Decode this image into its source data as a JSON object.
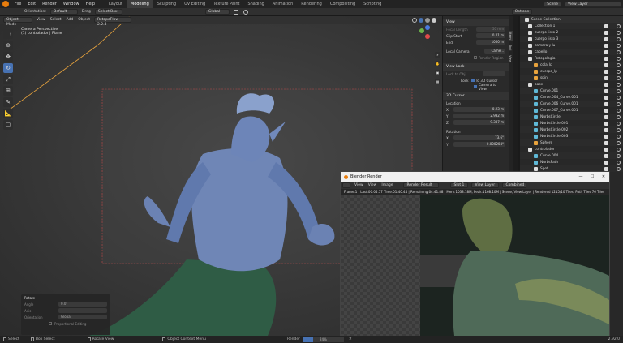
{
  "topbar": {
    "menus": [
      "File",
      "Edit",
      "Render",
      "Window",
      "Help"
    ],
    "workspaces": [
      "Layout",
      "Modeling",
      "Sculpting",
      "UV Editing",
      "Texture Paint",
      "Shading",
      "Animation",
      "Rendering",
      "Compositing",
      "Scripting"
    ],
    "active_workspace": "Modeling",
    "scene": "Scene",
    "view_layer": "View Layer"
  },
  "header": {
    "orientation_label": "Orientation:",
    "orientation_value": "Default",
    "drag_label": "Drag",
    "select_box": "Select Box",
    "transform": "Global",
    "options": "Options"
  },
  "viewport": {
    "mode": "Object Mode",
    "menus": [
      "View",
      "Select",
      "Add",
      "Object"
    ],
    "retopoflow": "RetopoFlow 2.2.4",
    "camera_line1": "Camera Perspective",
    "camera_line2": "(1) controlador | Plane"
  },
  "npanel": {
    "view_section": "View",
    "focal_length_label": "Focal Length",
    "focal_length": "50 mm",
    "clip_start_label": "Clip Start",
    "clip_start": "0.01 m",
    "end_label": "End",
    "clip_end": "1000 m",
    "local_camera_label": "Local Camera",
    "local_camera_value": "Came...",
    "render_region": "Render Region",
    "view_lock_section": "View Lock",
    "lock_to_object": "Lock to Obj...",
    "lock_label": "Lock",
    "to_3d_cursor": "To 3D Cursor",
    "camera_to_view": "Camera to View",
    "cursor_section": "3D Cursor",
    "location_label": "Location",
    "loc_x_label": "X",
    "loc_x": "0.23 m",
    "loc_y_label": "Y",
    "loc_y": "2.932 m",
    "loc_z_label": "Z",
    "loc_z": "-9.337 m",
    "rotation_label": "Rotation",
    "rot_x_label": "X",
    "rot_x": "73.6°",
    "rot_y_label": "Y",
    "rot_y": "-0.000204°",
    "tabs": [
      "Item",
      "Tool",
      "View"
    ]
  },
  "outliner": {
    "header": "Scene Collection",
    "items": [
      {
        "label": "Collection 1",
        "indent": 1,
        "color": "#dddddd"
      },
      {
        "label": "cuerpo listo 2",
        "indent": 1,
        "color": "#dddddd"
      },
      {
        "label": "cuerpo listo 3",
        "indent": 1,
        "color": "#dddddd"
      },
      {
        "label": "camara y lu",
        "indent": 1,
        "color": "#dddddd"
      },
      {
        "label": "cabello",
        "indent": 1,
        "color": "#dddddd"
      },
      {
        "label": "Retopologia",
        "indent": 1,
        "color": "#dddddd"
      },
      {
        "label": "cola_lp",
        "indent": 2,
        "color": "#e8a33d"
      },
      {
        "label": "cuerpo_lp",
        "indent": 2,
        "color": "#e8a33d"
      },
      {
        "label": "spin",
        "indent": 2,
        "color": "#e8a33d"
      },
      {
        "label": "base",
        "indent": 1,
        "color": "#dddddd"
      },
      {
        "label": "Curve.001",
        "indent": 2,
        "color": "#5fb8d6"
      },
      {
        "label": "Curve.004_Curve.001",
        "indent": 2,
        "color": "#5fb8d6"
      },
      {
        "label": "Curve.006_Curve.001",
        "indent": 2,
        "color": "#5fb8d6"
      },
      {
        "label": "Curve.007_Curve.001",
        "indent": 2,
        "color": "#5fb8d6"
      },
      {
        "label": "NurbsCircle",
        "indent": 2,
        "color": "#5fb8d6"
      },
      {
        "label": "NurbsCircle.001",
        "indent": 2,
        "color": "#5fb8d6"
      },
      {
        "label": "NurbsCircle.002",
        "indent": 2,
        "color": "#5fb8d6"
      },
      {
        "label": "NurbsCircle.003",
        "indent": 2,
        "color": "#5fb8d6"
      },
      {
        "label": "Sphere",
        "indent": 2,
        "color": "#e8a33d"
      },
      {
        "label": "controlador",
        "indent": 1,
        "color": "#dddddd"
      },
      {
        "label": "Curve.004",
        "indent": 2,
        "color": "#5fb8d6"
      },
      {
        "label": "NurbsPath",
        "indent": 2,
        "color": "#5fb8d6"
      },
      {
        "label": "Spot",
        "indent": 2,
        "color": "#dddddd"
      }
    ]
  },
  "render_window": {
    "title": "Blender Render",
    "menus": [
      "View",
      "View",
      "Image"
    ],
    "image_name": "Render Result",
    "slot": "Slot 1",
    "view_layer": "View Layer",
    "pass": "Combined",
    "info": "Frame:1 | Last:00:05.57 Time:01:40.44 | Remaining:04:41.88 | Mem:1038.18M, Peak:1168.10M | Scene, View Layer | Rendered 1215/10 Tiles, Path Tiles 76 Tiles"
  },
  "operator_panel": {
    "title": "Rotate",
    "angle_label": "Angle",
    "angle_value": "0.0°",
    "axis_label": "Axis",
    "orientation_label": "Orientation",
    "orientation_value": "Global",
    "proportional": "Proportional Editing"
  },
  "statusbar": {
    "select": "Select",
    "box_select": "Box Select",
    "rotate_view": "Rotate View",
    "context_menu": "Object Context Menu",
    "render_label": "Render",
    "render_progress": 0.24,
    "render_percent": "24%",
    "version": "2.92.0"
  },
  "colors": {
    "accent": "#4772b3",
    "object_orange": "#e8a33d",
    "curve_cyan": "#5fb8d6",
    "figure_blue": "#6f86b6"
  }
}
